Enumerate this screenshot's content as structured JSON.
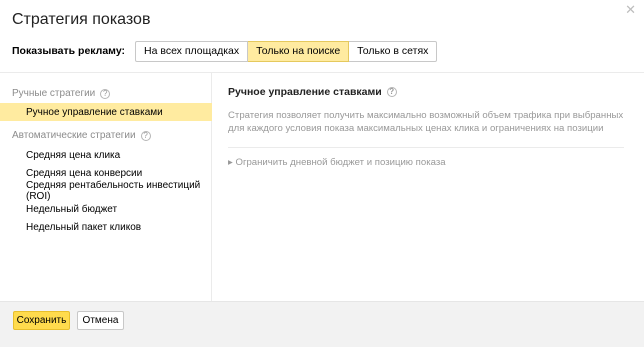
{
  "dialog": {
    "title": "Стратегия показов",
    "close_glyph": "✕"
  },
  "show_ads": {
    "label": "Показывать рекламу:",
    "options": [
      {
        "label": "На всех площадках",
        "selected": false
      },
      {
        "label": "Только на поиске",
        "selected": true
      },
      {
        "label": "Только в сетях",
        "selected": false
      }
    ]
  },
  "sidebar": {
    "manual_group": "Ручные стратегии",
    "manual_items": [
      "Ручное управление ставками"
    ],
    "auto_group": "Автоматические стратегии",
    "auto_items": [
      "Средняя цена клика",
      "Средняя цена конверсии",
      "Средняя рентабельность инвестиций (ROI)",
      "Недельный бюджет",
      "Недельный пакет кликов"
    ],
    "help_glyph": "?"
  },
  "content": {
    "title": "Ручное управление ставками",
    "description": "Стратегия позволяет получить максимально возможный объем трафика при выбранных для каждого условия показа максимальных ценах клика и ограничениях на позиции",
    "expander": "▸ Ограничить дневной бюджет и позицию показа"
  },
  "footer": {
    "save": "Сохранить",
    "cancel": "Отмена"
  },
  "colors": {
    "selected_bg": "#ffeba0",
    "primary_button": "#ffdb4d"
  }
}
